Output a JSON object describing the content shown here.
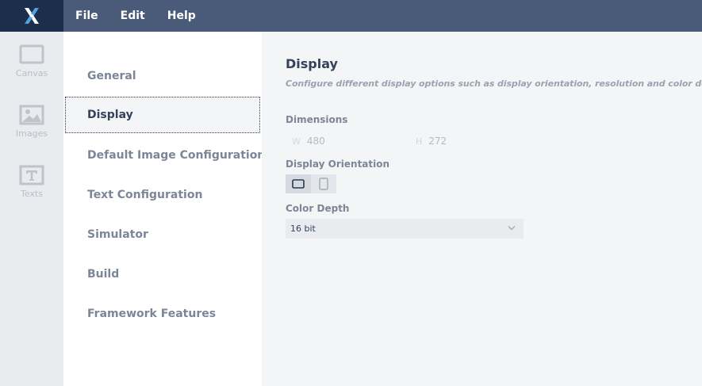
{
  "menu": {
    "file": "File",
    "edit": "Edit",
    "help": "Help"
  },
  "rail": {
    "canvas": "Canvas",
    "images": "Images",
    "texts": "Texts"
  },
  "nav": {
    "items": [
      "General",
      "Display",
      "Default Image Configuration",
      "Text Configuration",
      "Simulator",
      "Build",
      "Framework Features"
    ],
    "active": "Display"
  },
  "display": {
    "title": "Display",
    "subtitle": "Configure different display options such as display orientation, resolution and color depth.",
    "dimensions_label": "Dimensions",
    "width_prefix": "W",
    "width_value": "480",
    "height_prefix": "H",
    "height_value": "272",
    "orientation_label": "Display Orientation",
    "orientation_selected": "landscape",
    "color_depth_label": "Color Depth",
    "color_depth_value": "16 bit"
  },
  "icons": {
    "logo": "x-logo-icon",
    "canvas": "canvas-icon",
    "images": "image-icon",
    "texts": "text-icon",
    "landscape": "landscape-icon",
    "portrait": "portrait-icon",
    "dropdown": "chevron-down-icon"
  },
  "colors": {
    "topbar": "#495b79",
    "logo_bg": "#1b2e4c",
    "logo_accent": "#4ea3e0",
    "text_primary": "#34425a",
    "text_muted": "#7d8697"
  }
}
